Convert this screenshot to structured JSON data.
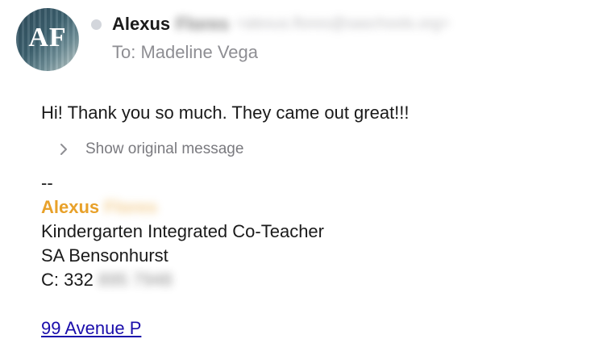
{
  "sender": {
    "avatar_initials": "AF",
    "first_name": "Alexus",
    "last_name_redacted": "Flores",
    "email_redacted": "<alexus.flores@saschools.org>"
  },
  "recipient": {
    "to_label": "To: Madeline Vega"
  },
  "message": {
    "body": "Hi! Thank you so much. They came out great!!!",
    "show_original_label": "Show original message"
  },
  "signature": {
    "separator": "--",
    "first_name": "Alexus",
    "last_name_redacted": "Flores",
    "title": "Kindergarten Integrated Co-Teacher",
    "school": "SA Bensonhurst",
    "phone_prefix": "C: 332",
    "phone_redacted": "895 7948",
    "address": "99 Avenue P"
  },
  "colors": {
    "signature_name": "#e8a12a",
    "link": "#1a0dab",
    "muted": "#8e8e93",
    "status_dot": "#d3d6dc"
  },
  "icons": {
    "status": "status-dot-icon",
    "expand": "chevron-right-icon"
  }
}
